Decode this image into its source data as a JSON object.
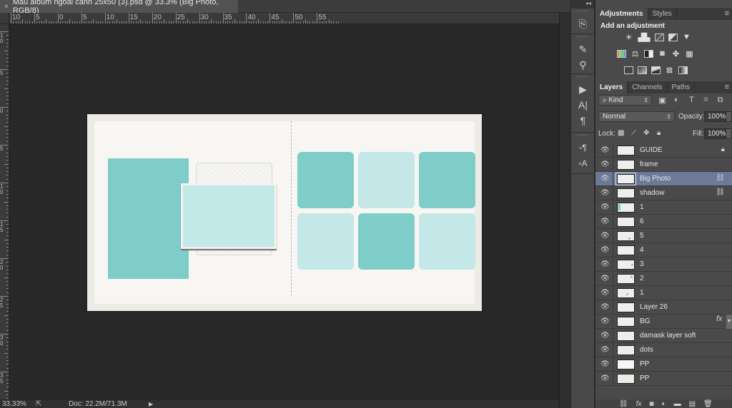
{
  "document_tab": {
    "close_icon": "×",
    "title": "Mau album ngoai canh 25x50 (3).psd @ 33.3% (Big Photo, RGB/8)"
  },
  "rulers": {
    "top_labels": [
      "10",
      "5",
      "0",
      "5",
      "10",
      "15",
      "20",
      "25",
      "30",
      "35",
      "40",
      "45",
      "50",
      "55"
    ],
    "left_labels": [
      "1 0",
      "5",
      "0",
      "5",
      "1 0",
      "1 5",
      "2 0",
      "2 5",
      "3 0",
      "3 5"
    ]
  },
  "canvas": {
    "accent_dark": "#7ecdc8",
    "accent_light": "#c3e8e7",
    "page_bg": "#f8f6f3",
    "tiles": [
      {
        "row": 1,
        "col": 1,
        "tone": "dark"
      },
      {
        "row": 1,
        "col": 2,
        "tone": "light"
      },
      {
        "row": 1,
        "col": 3,
        "tone": "dark"
      },
      {
        "row": 2,
        "col": 1,
        "tone": "light"
      },
      {
        "row": 2,
        "col": 2,
        "tone": "dark"
      },
      {
        "row": 2,
        "col": 3,
        "tone": "light"
      }
    ]
  },
  "status_bar": {
    "zoom": "33.33%",
    "share_icon": "share-icon",
    "doc_size": "Doc: 22.2M/71.3M",
    "arrow": "▶"
  },
  "mini_dock": {
    "collapse": "◂◂",
    "icons": [
      "history-icon",
      "brush-presets-icon",
      "clone-source-icon",
      "play-actions-icon",
      "character-icon",
      "paragraph-icon",
      "paragraph-styles-icon",
      "character-styles-icon"
    ]
  },
  "adjustments_panel": {
    "tabs": [
      {
        "label": "Adjustments",
        "active": true
      },
      {
        "label": "Styles",
        "active": false
      }
    ],
    "menu": "≡",
    "title": "Add an adjustment",
    "row1": [
      "brightness-contrast-icon",
      "levels-icon",
      "curves-icon",
      "exposure-icon",
      "vibrance-icon"
    ],
    "row2": [
      "hue-saturation-icon",
      "color-balance-icon",
      "black-white-icon",
      "photo-filter-icon",
      "channel-mixer-icon",
      "color-lookup-icon"
    ],
    "row3": [
      "invert-icon",
      "posterize-icon",
      "threshold-icon",
      "selective-color-icon",
      "gradient-map-icon"
    ]
  },
  "layers_panel": {
    "tabs": [
      {
        "label": "Layers",
        "active": true
      },
      {
        "label": "Channels",
        "active": false
      },
      {
        "label": "Paths",
        "active": false
      }
    ],
    "menu": "≡",
    "filter_kind": "Kind",
    "filter_icons": [
      "pixel-filter-icon",
      "adjustment-filter-icon",
      "type-filter-icon",
      "shape-filter-icon",
      "smart-object-filter-icon"
    ],
    "blend_mode": "Normal",
    "opacity_label": "Opacity:",
    "opacity_value": "100%",
    "lock_label": "Lock:",
    "fill_label": "Fill:",
    "fill_value": "100%",
    "layers": [
      {
        "name": "GUIDE",
        "badge": "lock",
        "selected": false
      },
      {
        "name": "frame",
        "badge": "",
        "selected": false
      },
      {
        "name": "Big Photo",
        "badge": "link",
        "selected": true
      },
      {
        "name": "shadow",
        "badge": "link",
        "selected": false
      },
      {
        "name": "1",
        "badge": "",
        "selected": false
      },
      {
        "name": "6",
        "badge": "",
        "selected": false
      },
      {
        "name": "5",
        "badge": "",
        "selected": false
      },
      {
        "name": "4",
        "badge": "",
        "selected": false
      },
      {
        "name": "3",
        "badge": "",
        "selected": false
      },
      {
        "name": "2",
        "badge": "",
        "selected": false
      },
      {
        "name": "1",
        "badge": "",
        "selected": false
      },
      {
        "name": "Layer 26",
        "badge": "",
        "selected": false
      },
      {
        "name": "BG",
        "badge": "fx",
        "selected": false
      },
      {
        "name": "damask layer soft",
        "badge": "",
        "selected": false
      },
      {
        "name": "dots",
        "badge": "",
        "selected": false
      },
      {
        "name": "PP",
        "badge": "",
        "selected": false
      },
      {
        "name": "PP",
        "badge": "",
        "selected": false
      }
    ],
    "fx_label": "fx",
    "footer_icons": [
      "link-layers-icon",
      "add-style-icon",
      "add-mask-icon",
      "new-fill-adjustment-icon",
      "new-group-icon",
      "new-layer-icon",
      "delete-layer-icon"
    ]
  }
}
